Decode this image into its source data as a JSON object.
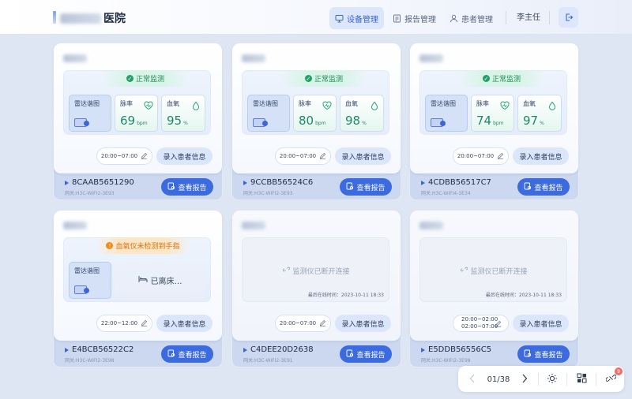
{
  "header": {
    "hospital_suffix": "医院",
    "nav": [
      {
        "label": "设备管理",
        "icon": "monitor-icon",
        "active": true
      },
      {
        "label": "报告管理",
        "icon": "report-icon",
        "active": false
      },
      {
        "label": "患者管理",
        "icon": "user-icon",
        "active": false
      }
    ],
    "user": "李主任"
  },
  "labels": {
    "radar": "雷达谐图",
    "pulse": "脉率",
    "spo2": "血氧",
    "bpm": "bpm",
    "percent": "%",
    "enter_patient": "录入患者信息",
    "view_report": "查看报告",
    "left_bed": "已离床…",
    "disconnected": "监测仪已断开连接",
    "last_online_prefix": "最后在线时间："
  },
  "cards": [
    {
      "status": "正常监测",
      "pulse": "69",
      "spo2": "95",
      "time": "20:00~07:00",
      "sn": "8CAAB5651290",
      "gateway": "网关:H3C-WIFI2-3E93"
    },
    {
      "status": "正常监测",
      "pulse": "80",
      "spo2": "98",
      "time": "20:00~07:00",
      "sn": "9CCBB56524C6",
      "gateway": "网关:H3C-WIFI2-3E93"
    },
    {
      "status": "正常监测",
      "pulse": "74",
      "spo2": "97",
      "time": "20:00~07:00",
      "sn": "4CDBB56517C7",
      "gateway": "网关:H3C-WIFI4-3E34"
    },
    {
      "status": "血氧仪未检测到手指",
      "time": "22:00~12:00",
      "sn": "E4BCB56522C2",
      "gateway": "网关:H3C-WIFI2-3E98"
    },
    {
      "last_online": "最后在线时间：2023-10-11 18:33",
      "time": "20:00~07:00",
      "sn": "C4DEE20D2638",
      "gateway": "网关:H3C-WIFI2-3E91"
    },
    {
      "last_online": "最后在线时间：2023-10-11 18:33",
      "time_line1": "20:00~02:00",
      "time_line2": "02:00~07:00",
      "sn": "E5DDB56556C5",
      "gateway": "网关:H3C-WIFI2-3E98"
    }
  ],
  "pager": {
    "page": "01/38",
    "notif_count": "9"
  },
  "colors": {
    "accent": "#3c6be0",
    "ok": "#23a06a",
    "warn": "#f08a1d"
  }
}
